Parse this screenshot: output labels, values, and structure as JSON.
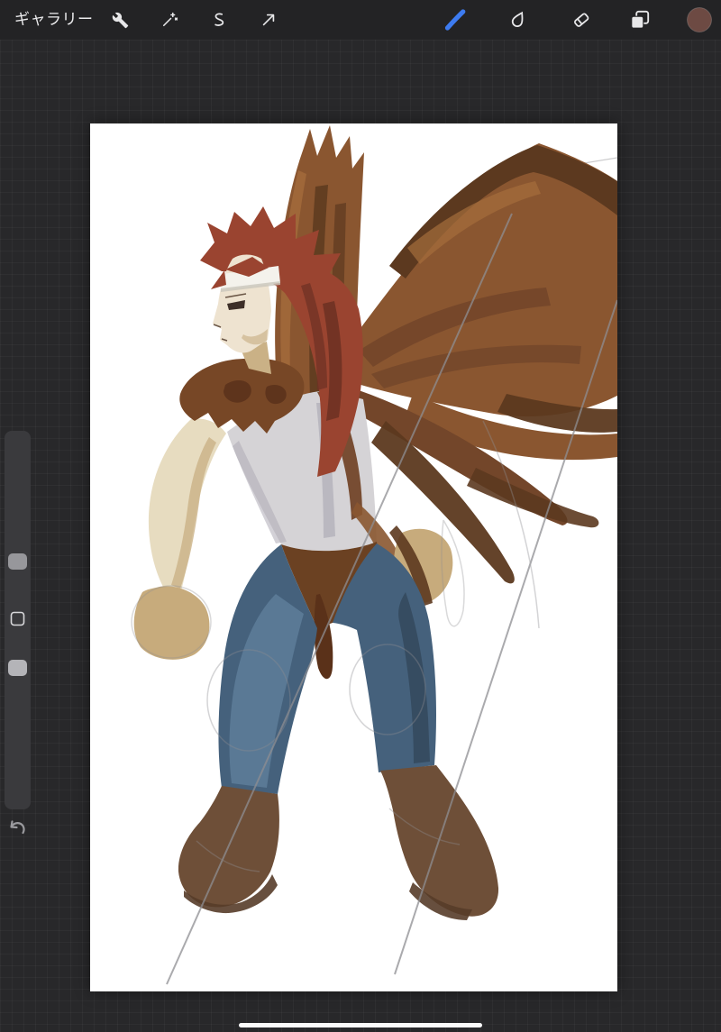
{
  "topbar": {
    "gallery_label": "ギャラリー",
    "bar_color": "#232325",
    "button_circle_color": "#3a3a3e",
    "icon_color": "#e7e7e9",
    "paint_stroke_color": "#3d7bf0",
    "current_color": "#6d4a43",
    "left_tools": [
      {
        "id": "actions",
        "icon": "wrench-icon"
      },
      {
        "id": "adjustments",
        "icon": "magic-wand-icon"
      },
      {
        "id": "selection",
        "icon": "selection-s-icon"
      },
      {
        "id": "transform",
        "icon": "transform-arrow-icon"
      }
    ],
    "right_tools": [
      {
        "id": "paint",
        "icon": "brush-stroke-icon"
      },
      {
        "id": "smudge",
        "icon": "smudge-drop-icon"
      },
      {
        "id": "erase",
        "icon": "eraser-icon"
      },
      {
        "id": "layers",
        "icon": "layers-icon"
      },
      {
        "id": "color",
        "icon": "color-swatch-circle"
      }
    ]
  },
  "workspace": {
    "background": "#28282a",
    "grid_line": "#323235",
    "canvas_color": "#ffffff"
  },
  "sidebar": {
    "bar_color": "#3b3b3e",
    "size_handle_color": "#97979b",
    "opacity_handle_color": "#b4b4b8",
    "modify_outline_color": "#d8d8db",
    "undo_icon": "undo-arrow-icon",
    "undo_color": "#9a9a9e"
  },
  "home_indicator": {
    "color": "#fbfbfb"
  },
  "artwork": {
    "alt": "Digital painting of a winged young man seen from behind, head in profile facing left, with large brown wings, red-brown spiky hair, white headband, fur collar, sleeveless light shirt, blue jeans and brown boots over loose gray sketch lines",
    "colors": {
      "wing_base": "#8a5630",
      "wing_dark": "#5c391f",
      "wing_mid": "#73462a",
      "wing_light": "#a56d3c",
      "hair": "#9a4430",
      "hair_dark": "#6f3224",
      "skin": "#e7dcc0",
      "skin_shadow": "#cab186",
      "face": "#eee3d0",
      "face_line": "#6b5747",
      "eye": "#3d2f28",
      "headband": "#f4f2ec",
      "headband_shadow": "#c9c5bc",
      "shirt": "#d5d3d6",
      "shirt_shadow": "#aeacb6",
      "fur": "#774726",
      "fur_dark": "#57301a",
      "shorts": "#6b4122",
      "shorts_dark": "#5a3119",
      "jeans": "#45617c",
      "jeans_light": "#5e7e9a",
      "jeans_dark": "#344a5e",
      "boot": "#6e4f38",
      "boot_dark": "#563c29",
      "glove": "#c7ab7c",
      "sketch": "#8e8e92"
    }
  }
}
